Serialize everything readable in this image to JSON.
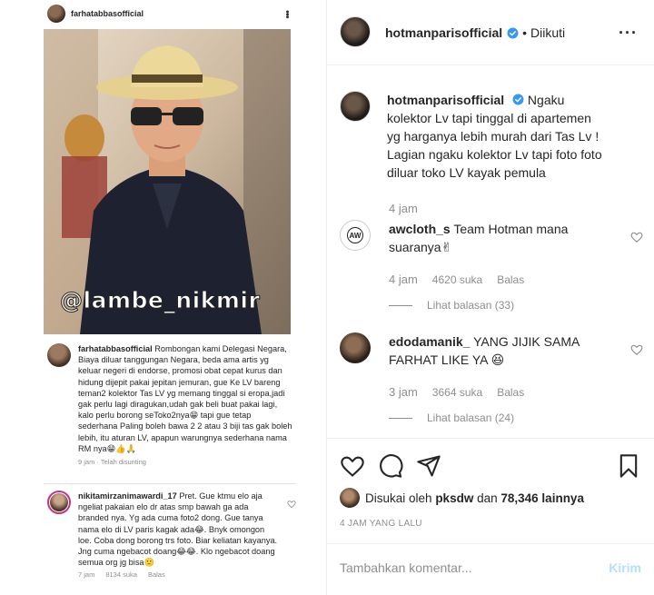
{
  "embed": {
    "username": "farhatabbasofficial",
    "watermark": "@lambe_nikmir",
    "caption_user": "farhatabbasofficial",
    "caption_text": "Rombongan kami Delegasi Negara, Biaya diluar tanggungan Negara, beda ama artis yg keluar negeri di endorse, promosi obat cepat kurus dan hidung dijepit pakai jepitan jemuran, gue Ke LV bareng teman2 kolektor Tas LV yg memang tinggal si eropa,jadi gak perlu lagi diragukan,udah gak beli buat pakai lagi, kalo perlu borong seToko2nya😁 tapi gue tetap sederhana Paling boleh bawa 2 2 atau 3 biji tas gak boleh lebih, itu aturan LV, apapun warungnya sederhana nama RM nya😁👍🙏",
    "caption_meta": "9 jam · Telah disunting",
    "comment_user": "nikitamirzanimawardi_17",
    "comment_text": "Pret. Gue ktmu elo aja ngeliat pakaian elo dr atas smp bawah ga ada branded nya. Yg ada cuma foto2 dong. Gue tanya nama elo di LV paris kagak ada😂. Bnyk omongon loe. Coba dong borong trs foto. Biar keliatan kayanya. Jng cuma ngebacot doang😂😂. Klo ngebacot doang semua org jg bisa🙂",
    "comment_time": "7 jam",
    "comment_likes": "8134 suka",
    "comment_reply": "Balas"
  },
  "header": {
    "username": "hotmanparisofficial",
    "separator": "•",
    "following": "Diikuti",
    "more": "···"
  },
  "post": {
    "caption_user": "hotmanparisofficial",
    "caption_text": "Ngaku kolektor Lv tapi tinggal di apartemen yg harganya lebih murah dari Tas Lv ! Lagian ngaku kolektor Lv tapi foto foto diluar toko LV kayak pemula",
    "caption_time": "4 jam"
  },
  "comments": [
    {
      "user": "awcloth_s",
      "text": "Team Hotman mana suaranya✌",
      "time": "4 jam",
      "likes": "4620 suka",
      "reply": "Balas",
      "replies": "Lihat balasan (33)",
      "avatar_text": "AW"
    },
    {
      "user": "edodamanik_",
      "text": "YANG JIJIK SAMA FARHAT LIKE YA 😆",
      "time": "3 jam",
      "likes": "3664 suka",
      "reply": "Balas",
      "replies": "Lihat balasan (24)"
    }
  ],
  "likes": {
    "prefix": "Disukai oleh",
    "user": "pksdw",
    "middle": "dan",
    "count": "78,346 lainnya"
  },
  "date": "4 JAM YANG LALU",
  "input": {
    "placeholder": "Tambahkan komentar...",
    "send": "Kirim"
  },
  "colors": {
    "verified": "#3897f0",
    "send_disabled": "#b2dffc",
    "muted": "#8e8e8e"
  }
}
